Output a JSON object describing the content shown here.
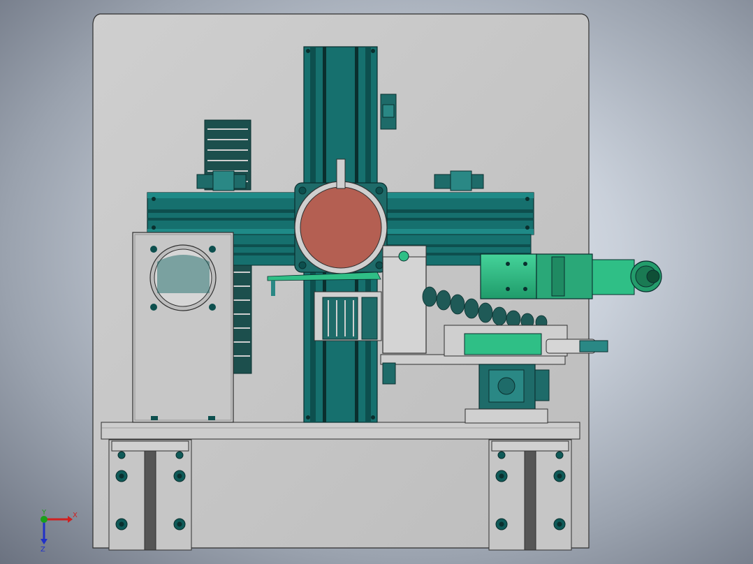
{
  "view": {
    "colors": {
      "background_center": "#e9edf3",
      "background_edge": "#6b7280",
      "base_plate": "#c3c3c3",
      "outline": "#2f2f2f",
      "frame_teal": "#16706e",
      "frame_teal_dark": "#0d4f4e",
      "rotary_disk": "#b45f52",
      "gear_motor_green": "#2fbf86",
      "cable_chain": "#1f5a57"
    }
  },
  "triad": {
    "x_label": "X",
    "y_label": "Y",
    "z_label": "Z",
    "x_color": "#d02020",
    "y_color": "#1aa01a",
    "z_color": "#2030c8"
  }
}
